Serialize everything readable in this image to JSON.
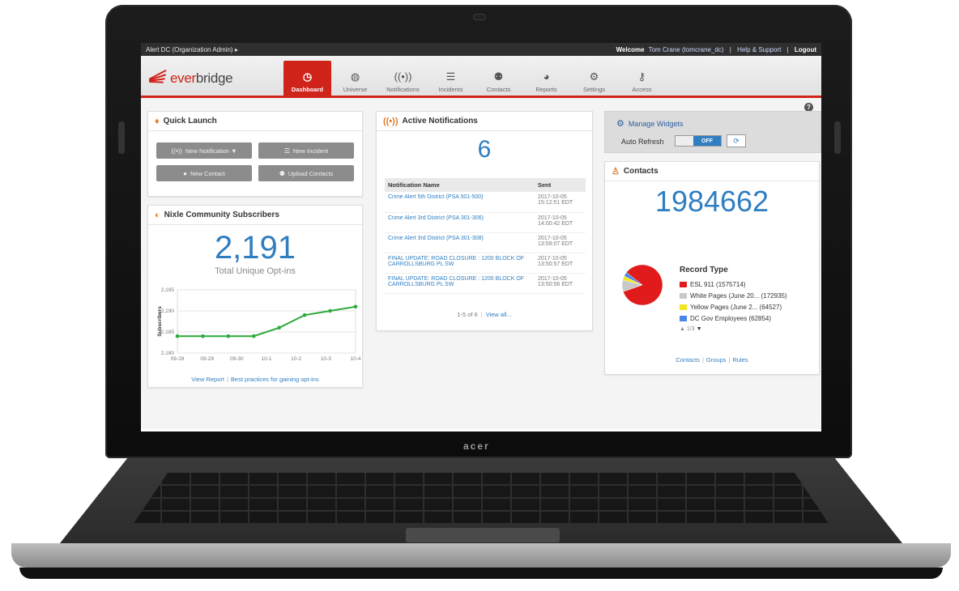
{
  "device": {
    "brand": "acer"
  },
  "topbar": {
    "org": "Alert DC (Organization Admin)",
    "welcome_prefix": "Welcome",
    "user": "Tom Crane (tomcrane_dc)",
    "help": "Help & Support",
    "logout": "Logout"
  },
  "logo": {
    "ever": "ever",
    "bridge": "bridge"
  },
  "nav": [
    {
      "label": "Dashboard",
      "icon": "dashboard-icon",
      "active": true
    },
    {
      "label": "Universe",
      "icon": "globe-icon"
    },
    {
      "label": "Notifications",
      "icon": "broadcast-icon"
    },
    {
      "label": "Incidents",
      "icon": "list-icon"
    },
    {
      "label": "Contacts",
      "icon": "contacts-icon"
    },
    {
      "label": "Reports",
      "icon": "pie-icon"
    },
    {
      "label": "Settings",
      "icon": "gear-icon"
    },
    {
      "label": "Access",
      "icon": "key-icon"
    }
  ],
  "quick_launch": {
    "title": "Quick Launch",
    "buttons": [
      "New Notification ▼",
      "New Incident",
      "New Contact",
      "Upload Contacts"
    ]
  },
  "nixle": {
    "title": "Nixle Community Subscribers",
    "count": "2,191",
    "caption": "Total Unique Opt-ins",
    "links": [
      "View Report",
      "Best practices for gaining opt-ins"
    ]
  },
  "chart_data": {
    "type": "line",
    "title": "",
    "xlabel": "",
    "ylabel": "Subscribers",
    "categories": [
      "09-28",
      "09-29",
      "09-30",
      "10-1",
      "10-2",
      "10-3",
      "10-4"
    ],
    "x": [
      "09-28",
      "09-28",
      "09-29",
      "09-30",
      "10-1",
      "10-2",
      "10-3",
      "10-4"
    ],
    "series": [
      {
        "name": "",
        "values": [
          2184,
          2184,
          2184,
          2184,
          2186,
          2189,
          2190,
          2191
        ]
      }
    ],
    "y_ticks": [
      2180,
      2185,
      2190,
      2195
    ],
    "ylim": [
      2180,
      2195
    ],
    "grid": true,
    "color": "#2eaa3c"
  },
  "active_notifications": {
    "title": "Active Notifications",
    "count": "6",
    "headers": [
      "Notification Name",
      "Sent"
    ],
    "rows": [
      {
        "name": "Crime Alert 5th District (PSA 501-500)",
        "sent": "2017-10-05 15:12:51 EDT"
      },
      {
        "name": "Crime Alert 3rd District (PSA 301-306)",
        "sent": "2017-10-05 14:00:42 EDT"
      },
      {
        "name": "Crime Alert 3rd District (PSA 301-308)",
        "sent": "2017-10-05 13:59:07 EDT"
      },
      {
        "name": "FINAL UPDATE: ROAD CLOSURE : 1200 BLOCK OF CARROLLSBURG PL SW",
        "sent": "2017-10-05 13:50:57 EDT"
      },
      {
        "name": "FINAL UPDATE: ROAD CLOSURE : 1200 BLOCK OF CARROLLSBURG PL SW",
        "sent": "2017-10-05 13:50:56 EDT"
      }
    ],
    "pager": "1-5 of 6",
    "view_all": "View all..."
  },
  "manage_widgets": {
    "title": "Manage Widgets",
    "auto_refresh_label": "Auto Refresh",
    "toggle_state": "OFF",
    "help": "?"
  },
  "contacts": {
    "title": "Contacts",
    "count": "1984662",
    "legend_title": "Record Type",
    "legend": [
      {
        "label": "ESL 911 (1575714)",
        "value": 1575714,
        "color": "#e11b1b"
      },
      {
        "label": "White Pages (June 20... (172935)",
        "value": 172935,
        "color": "#c8c8c8"
      },
      {
        "label": "Yellow Pages (June 2... (64527)",
        "value": 64527,
        "color": "#f2e622"
      },
      {
        "label": "DC Gov Employees (62854)",
        "value": 62854,
        "color": "#4a86e8"
      }
    ],
    "legend_page": "1/3",
    "links": [
      "Contacts",
      "Groups",
      "Rules"
    ]
  }
}
